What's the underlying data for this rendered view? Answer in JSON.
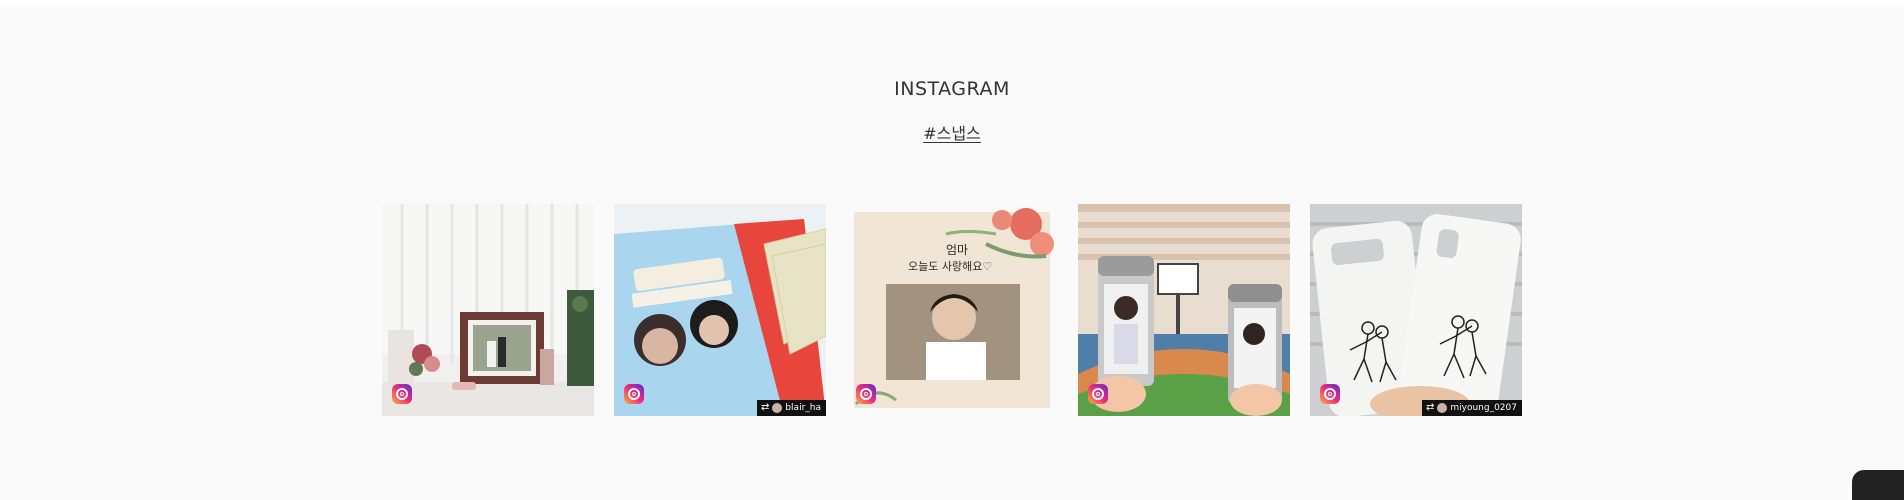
{
  "section": {
    "title": "INSTAGRAM",
    "hashtag": "#스냅스"
  },
  "posts": [
    {
      "alt": "photo frame",
      "credit": ""
    },
    {
      "alt": "book",
      "credit": "blair_ha"
    },
    {
      "alt": "photobook",
      "credit": ""
    },
    {
      "alt": "tumbler",
      "credit": ""
    },
    {
      "alt": "phone case",
      "credit": "miyoung_0207"
    }
  ],
  "icons": {
    "instagram": "instagram-icon",
    "repost": "repost-icon",
    "chat": "chat-icon"
  },
  "colors": {
    "background": "#fafafa",
    "text": "#333333",
    "credit_bg": "#111111"
  }
}
